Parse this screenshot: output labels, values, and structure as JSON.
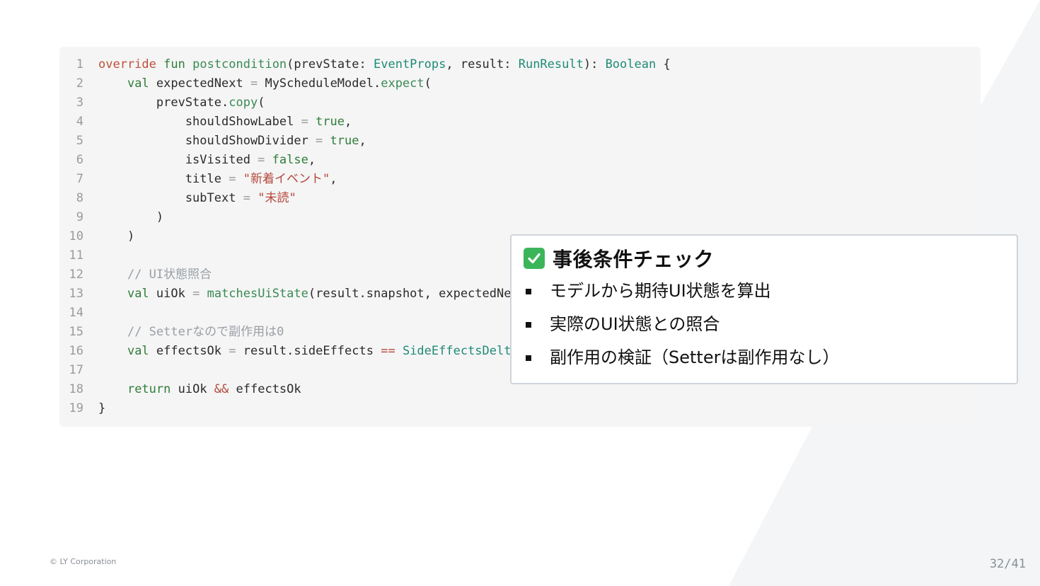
{
  "code": {
    "lines": [
      {
        "n": "1",
        "tokens": [
          [
            "override",
            "override"
          ],
          [
            "plain",
            " "
          ],
          [
            "kw",
            "fun"
          ],
          [
            "plain",
            " "
          ],
          [
            "fn",
            "postcondition"
          ],
          [
            "plain",
            "(prevState: "
          ],
          [
            "type",
            "EventProps"
          ],
          [
            "plain",
            ", result: "
          ],
          [
            "type",
            "RunResult"
          ],
          [
            "plain",
            "): "
          ],
          [
            "type",
            "Boolean"
          ],
          [
            "plain",
            " {"
          ]
        ]
      },
      {
        "n": "2",
        "tokens": [
          [
            "plain",
            "    "
          ],
          [
            "kw",
            "val"
          ],
          [
            "plain",
            " expectedNext "
          ],
          [
            "op",
            "="
          ],
          [
            "plain",
            " MyScheduleModel."
          ],
          [
            "fn",
            "expect"
          ],
          [
            "plain",
            "("
          ]
        ]
      },
      {
        "n": "3",
        "tokens": [
          [
            "plain",
            "        prevState."
          ],
          [
            "fn",
            "copy"
          ],
          [
            "plain",
            "("
          ]
        ]
      },
      {
        "n": "4",
        "tokens": [
          [
            "plain",
            "            shouldShowLabel "
          ],
          [
            "op",
            "="
          ],
          [
            "plain",
            " "
          ],
          [
            "bool",
            "true"
          ],
          [
            "plain",
            ","
          ]
        ]
      },
      {
        "n": "5",
        "tokens": [
          [
            "plain",
            "            shouldShowDivider "
          ],
          [
            "op",
            "="
          ],
          [
            "plain",
            " "
          ],
          [
            "bool",
            "true"
          ],
          [
            "plain",
            ","
          ]
        ]
      },
      {
        "n": "6",
        "tokens": [
          [
            "plain",
            "            isVisited "
          ],
          [
            "op",
            "="
          ],
          [
            "plain",
            " "
          ],
          [
            "bool",
            "false"
          ],
          [
            "plain",
            ","
          ]
        ]
      },
      {
        "n": "7",
        "tokens": [
          [
            "plain",
            "            title "
          ],
          [
            "op",
            "="
          ],
          [
            "plain",
            " "
          ],
          [
            "str",
            "\"新着イベント\""
          ],
          [
            "plain",
            ","
          ]
        ]
      },
      {
        "n": "8",
        "tokens": [
          [
            "plain",
            "            subText "
          ],
          [
            "op",
            "="
          ],
          [
            "plain",
            " "
          ],
          [
            "str",
            "\"未読\""
          ]
        ]
      },
      {
        "n": "9",
        "tokens": [
          [
            "plain",
            "        )"
          ]
        ]
      },
      {
        "n": "10",
        "tokens": [
          [
            "plain",
            "    )"
          ]
        ]
      },
      {
        "n": "11",
        "tokens": []
      },
      {
        "n": "12",
        "tokens": [
          [
            "plain",
            "    "
          ],
          [
            "cmt",
            "// UI状態照合"
          ]
        ]
      },
      {
        "n": "13",
        "tokens": [
          [
            "plain",
            "    "
          ],
          [
            "kw",
            "val"
          ],
          [
            "plain",
            " uiOk "
          ],
          [
            "op",
            "="
          ],
          [
            "plain",
            " "
          ],
          [
            "fn",
            "matchesUiState"
          ],
          [
            "plain",
            "(result.snapshot, expectedNext)"
          ]
        ]
      },
      {
        "n": "14",
        "tokens": []
      },
      {
        "n": "15",
        "tokens": [
          [
            "plain",
            "    "
          ],
          [
            "cmt",
            "// Setterなので副作用は0"
          ]
        ]
      },
      {
        "n": "16",
        "tokens": [
          [
            "plain",
            "    "
          ],
          [
            "kw",
            "val"
          ],
          [
            "plain",
            " effectsOk "
          ],
          [
            "op",
            "="
          ],
          [
            "plain",
            " result.sideEffects "
          ],
          [
            "opred",
            "=="
          ],
          [
            "plain",
            " "
          ],
          [
            "type",
            "SideEffectsDelta"
          ],
          [
            "plain",
            "()"
          ]
        ]
      },
      {
        "n": "17",
        "tokens": []
      },
      {
        "n": "18",
        "tokens": [
          [
            "plain",
            "    "
          ],
          [
            "kw",
            "return"
          ],
          [
            "plain",
            " uiOk "
          ],
          [
            "opred",
            "&&"
          ],
          [
            "plain",
            " effectsOk"
          ]
        ]
      },
      {
        "n": "19",
        "tokens": [
          [
            "plain",
            "}"
          ]
        ]
      }
    ]
  },
  "callout": {
    "icon": "check-mark-icon",
    "title": "事後条件チェック",
    "items": [
      "モデルから期待UI状態を算出",
      "実際のUI状態との照合",
      "副作用の検証（Setterは副作用なし）"
    ]
  },
  "footer": {
    "copyright": "© LY Corporation",
    "page": "32/41"
  },
  "colors": {
    "check_green": "#3cb55a",
    "code_bg": "#f5f5f5",
    "keyword": "#2f7d3a",
    "string": "#b5483c"
  }
}
